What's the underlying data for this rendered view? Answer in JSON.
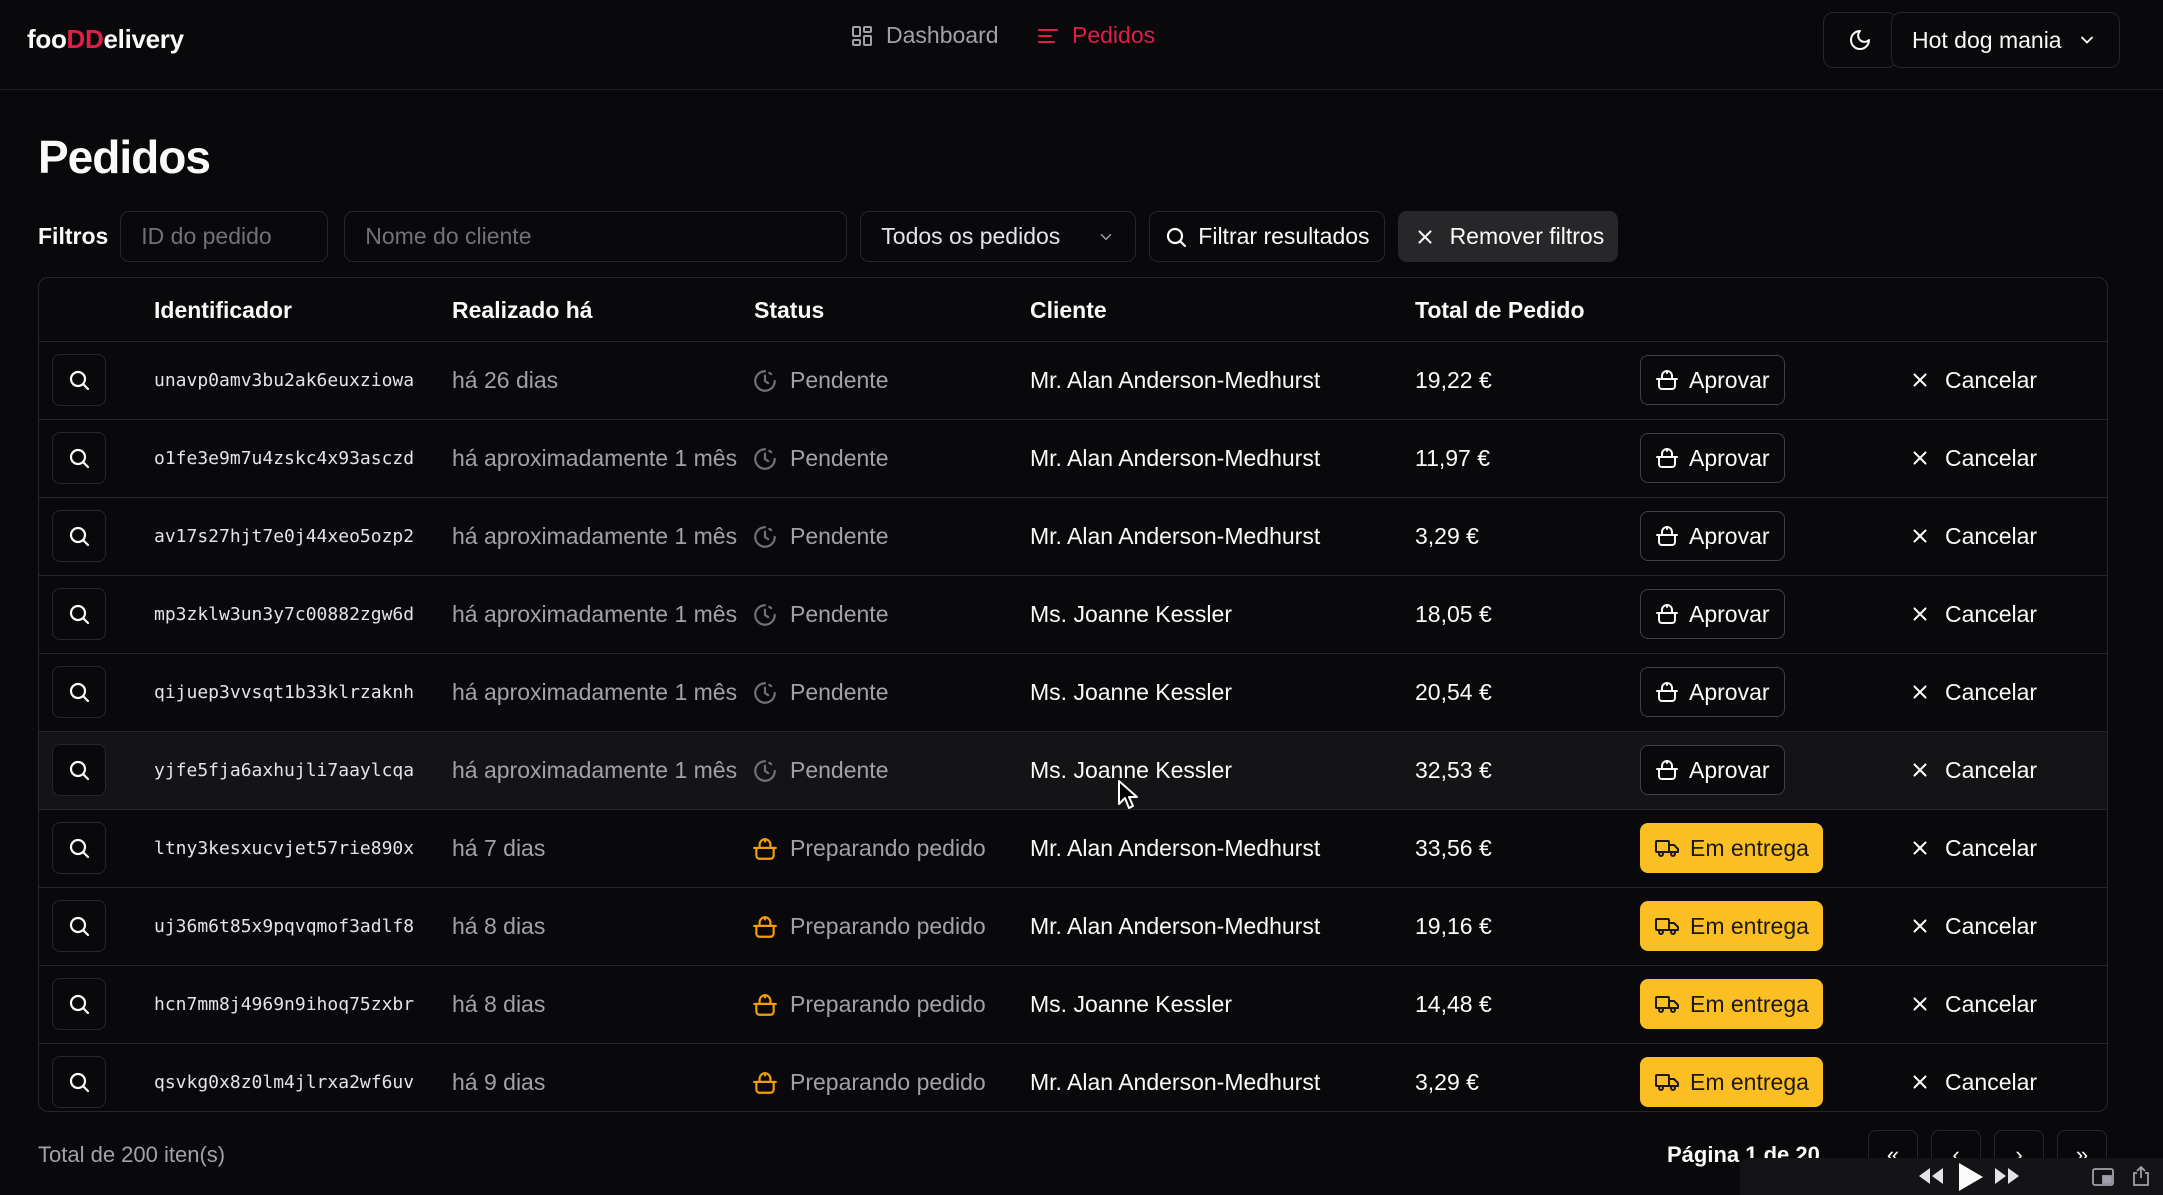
{
  "header": {
    "logo": {
      "part1": "foo",
      "part2": "DD",
      "part3": "elivery"
    },
    "nav": [
      {
        "label": "Dashboard",
        "icon": "dashboard-icon",
        "active": false
      },
      {
        "label": "Pedidos",
        "icon": "list-icon",
        "active": true
      }
    ],
    "store_name": "Hot dog mania",
    "colors": {
      "accent": "#e11d48",
      "background": "#09090b",
      "border": "#27272a",
      "deliver": "#fbbf24"
    }
  },
  "page_title": "Pedidos",
  "filters": {
    "label": "Filtros",
    "order_id_placeholder": "ID do pedido",
    "customer_placeholder": "Nome do cliente",
    "status_select": "Todos os pedidos",
    "filter_button": "Filtrar resultados",
    "clear_button": "Remover filtros"
  },
  "table": {
    "headers": {
      "id": "Identificador",
      "created": "Realizado há",
      "status": "Status",
      "customer": "Cliente",
      "total": "Total de Pedido"
    },
    "rows": [
      {
        "id": "unavp0amv3bu2ak6euxziowa",
        "created": "há 26 dias",
        "status": "Pendente",
        "customer": "Mr. Alan Anderson-Medhurst",
        "total": "19,22 €",
        "action": "Aprovar",
        "cancel": "Cancelar"
      },
      {
        "id": "o1fe3e9m7u4zskc4x93asczd",
        "created": "há aproximadamente 1 mês",
        "status": "Pendente",
        "customer": "Mr. Alan Anderson-Medhurst",
        "total": "11,97 €",
        "action": "Aprovar",
        "cancel": "Cancelar"
      },
      {
        "id": "av17s27hjt7e0j44xeo5ozp2",
        "created": "há aproximadamente 1 mês",
        "status": "Pendente",
        "customer": "Mr. Alan Anderson-Medhurst",
        "total": "3,29 €",
        "action": "Aprovar",
        "cancel": "Cancelar"
      },
      {
        "id": "mp3zklw3un3y7c00882zgw6d",
        "created": "há aproximadamente 1 mês",
        "status": "Pendente",
        "customer": "Ms. Joanne Kessler",
        "total": "18,05 €",
        "action": "Aprovar",
        "cancel": "Cancelar"
      },
      {
        "id": "qijuep3vvsqt1b33klrzaknh",
        "created": "há aproximadamente 1 mês",
        "status": "Pendente",
        "customer": "Ms. Joanne Kessler",
        "total": "20,54 €",
        "action": "Aprovar",
        "cancel": "Cancelar"
      },
      {
        "id": "yjfe5fja6axhujli7aaylcqa",
        "created": "há aproximadamente 1 mês",
        "status": "Pendente",
        "customer": "Ms. Joanne Kessler",
        "total": "32,53 €",
        "action": "Aprovar",
        "cancel": "Cancelar"
      },
      {
        "id": "ltny3kesxucvjet57rie890x",
        "created": "há 7 dias",
        "status": "Preparando pedido",
        "customer": "Mr. Alan Anderson-Medhurst",
        "total": "33,56 €",
        "action": "Em entrega",
        "cancel": "Cancelar"
      },
      {
        "id": "uj36m6t85x9pqvqmof3adlf8",
        "created": "há 8 dias",
        "status": "Preparando pedido",
        "customer": "Mr. Alan Anderson-Medhurst",
        "total": "19,16 €",
        "action": "Em entrega",
        "cancel": "Cancelar"
      },
      {
        "id": "hcn7mm8j4969n9ihoq75zxbr",
        "created": "há 8 dias",
        "status": "Preparando pedido",
        "customer": "Ms. Joanne Kessler",
        "total": "14,48 €",
        "action": "Em entrega",
        "cancel": "Cancelar"
      },
      {
        "id": "qsvkg0x8z0lm4jlrxa2wf6uv",
        "created": "há 9 dias",
        "status": "Preparando pedido",
        "customer": "Mr. Alan Anderson-Medhurst",
        "total": "3,29 €",
        "action": "Em entrega",
        "cancel": "Cancelar"
      }
    ]
  },
  "footer": {
    "total_items": "Total de 200 iten(s)",
    "page_label": "Página 1 de 20"
  }
}
